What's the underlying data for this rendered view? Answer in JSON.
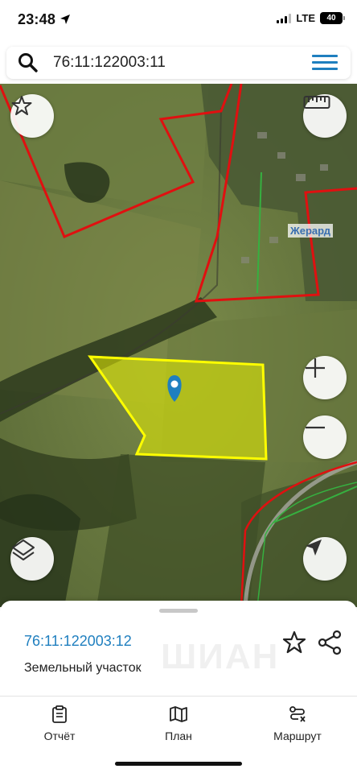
{
  "status_bar": {
    "time": "23:48",
    "network": "LTE",
    "battery": "40"
  },
  "search": {
    "query": "76:11:122003:11"
  },
  "map": {
    "parcel_color": "#e8f000",
    "boundary_color": "#e01010",
    "marker_color": "#1f7fbf"
  },
  "overlay_label": "Жерард",
  "sheet": {
    "parcel_id": "76:11:122003:12",
    "parcel_type": "Земельный участок",
    "watermark": "ШИАН"
  },
  "tabs": [
    {
      "label": "Отчёт",
      "icon": "report-icon"
    },
    {
      "label": "План",
      "icon": "map-plan-icon"
    },
    {
      "label": "Маршрут",
      "icon": "route-icon"
    }
  ],
  "accent_color": "#1f7fbf"
}
